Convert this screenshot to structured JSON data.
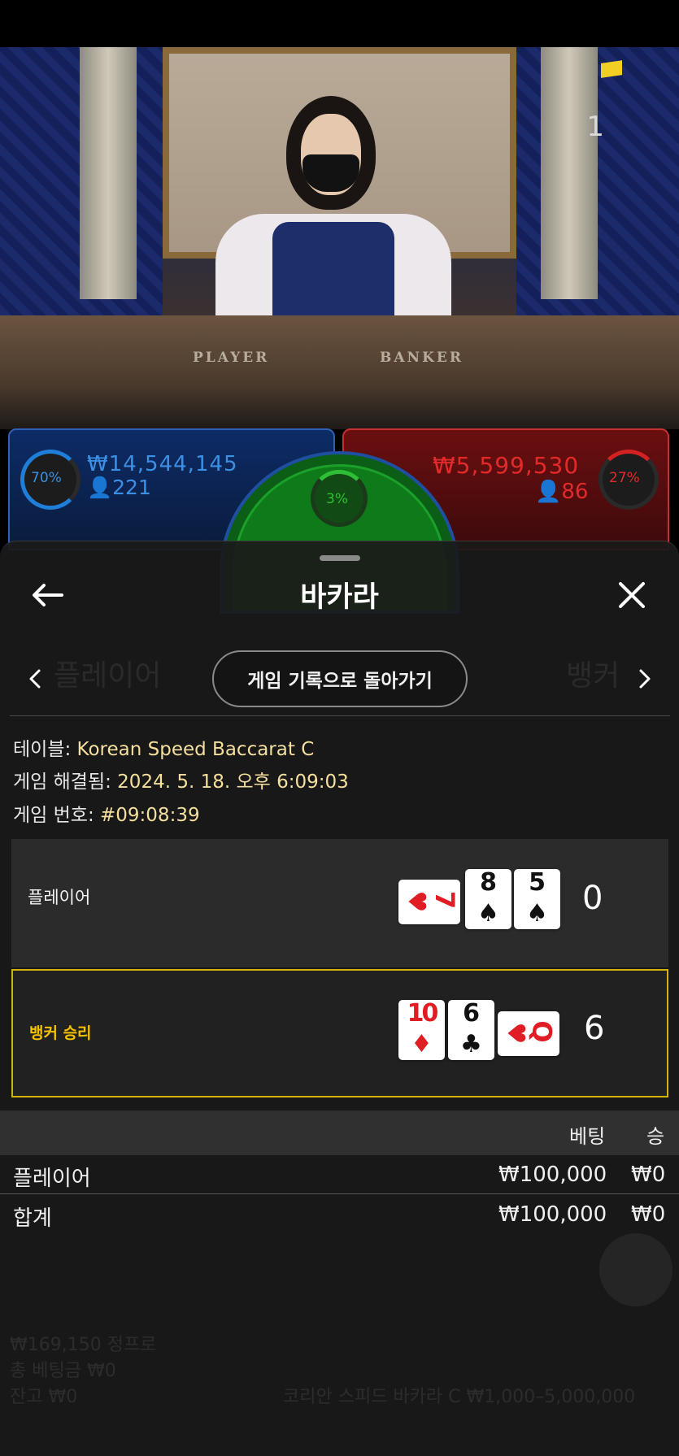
{
  "video": {
    "round_counter": "1",
    "table_player_label": "PLAYER",
    "table_banker_label": "BANKER"
  },
  "betting_board": {
    "player": {
      "percent": "70%",
      "amount": "₩14,544,145",
      "bettors": "221",
      "color": "#3b8fe4"
    },
    "tie": {
      "percent": "3%",
      "color": "#2fbf35"
    },
    "banker": {
      "percent": "27%",
      "amount": "₩5,599,530",
      "bettors": "86",
      "color": "#e32a2a"
    }
  },
  "sheet": {
    "title": "바카라",
    "return_button": "게임 기록으로 돌아가기",
    "ghost_left": "플레이어",
    "ghost_right": "뱅커",
    "info": {
      "table_label": "테이블: ",
      "table_value": "Korean Speed Baccarat C",
      "resolved_label": "게임 해결됨: ",
      "resolved_value": "2024. 5. 18. 오후 6:09:03",
      "game_no_label": "게임 번호: ",
      "game_no_value": "#09:08:39"
    },
    "hands": {
      "player": {
        "label": "플레이어",
        "score": "0",
        "cards": [
          {
            "rank": "7",
            "suit": "♥",
            "color": "red"
          },
          {
            "rank": "8",
            "suit": "♠",
            "color": "black"
          },
          {
            "rank": "5",
            "suit": "♠",
            "color": "black"
          }
        ]
      },
      "banker": {
        "label": "뱅커 승리",
        "score": "6",
        "cards": [
          {
            "rank": "10",
            "suit": "♦",
            "color": "red"
          },
          {
            "rank": "6",
            "suit": "♣",
            "color": "black"
          },
          {
            "rank": "Q",
            "suit": "♥",
            "color": "red"
          }
        ]
      }
    },
    "bets": {
      "col_bet": "베팅",
      "col_win": "승",
      "rows": [
        {
          "name": "플레이어",
          "bet": "₩100,000",
          "win": "₩0"
        }
      ],
      "total": {
        "name": "합계",
        "bet": "₩100,000",
        "win": "₩0"
      }
    },
    "accent_gold": "#d4b20e"
  },
  "background_footer": {
    "balance_line": "₩169,150 정프로",
    "total_bet": "총 베팅금 ₩0",
    "balance": "잔고 ₩0",
    "table_limits": "코리안 스피드 바카라 C ₩1,000–5,000,000"
  }
}
